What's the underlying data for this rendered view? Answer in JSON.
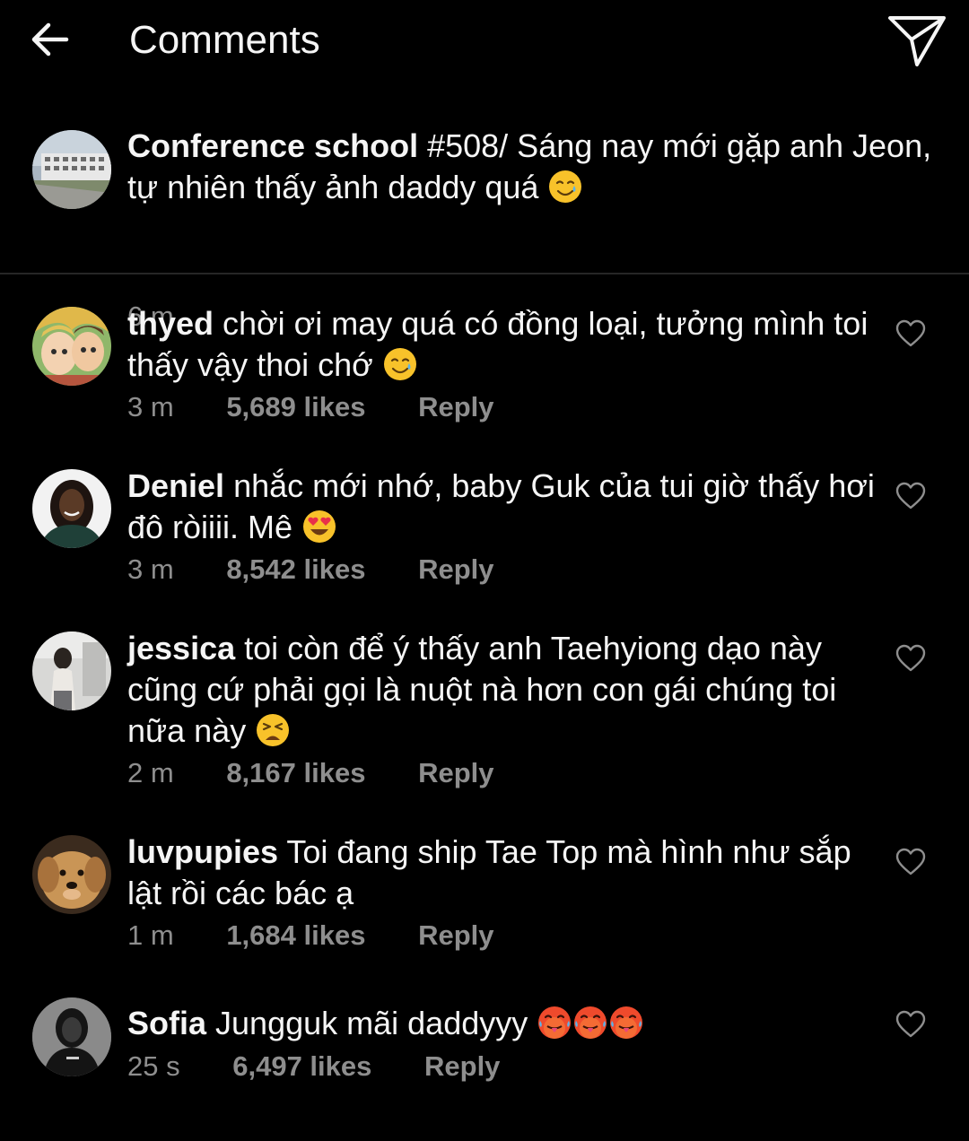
{
  "header": {
    "title": "Comments"
  },
  "caption": {
    "username": "Conference school",
    "text": "#508/ Sáng nay mới gặp anh Jeon, tự nhiên thấy ảnh daddy quá",
    "time": "6 m"
  },
  "comments": [
    {
      "username": "thyed",
      "text": "chời ơi may quá có đồng loại, tưởng mình toi thấy vậy thoi chớ",
      "time": "3 m",
      "likes": "5,689 likes",
      "reply": "Reply"
    },
    {
      "username": "Deniel",
      "text": "nhắc mới nhớ, baby Guk của tui giờ thấy hơi đô ròiiii. Mê",
      "time": "3 m",
      "likes": "8,542 likes",
      "reply": "Reply"
    },
    {
      "username": "jessica",
      "text": "toi còn để ý thấy anh Taehyiong dạo này cũng cứ phải gọi là nuột nà hơn con gái chúng toi nữa này",
      "time": "2 m",
      "likes": "8,167 likes",
      "reply": "Reply"
    },
    {
      "username": "luvpupies",
      "text": "Toi đang ship Tae Top mà hình như sắp lật rồi các bác ạ",
      "time": "1 m",
      "likes": "1,684 likes",
      "reply": "Reply"
    },
    {
      "username": "Sofia",
      "text": "Jungguk mãi daddyyy",
      "time": "25 s",
      "likes": "6,497 likes",
      "reply": "Reply"
    }
  ],
  "icons": {
    "back": "arrow-left-icon",
    "share": "paper-plane-icon",
    "like": "heart-outline-icon",
    "emoji_tear_smile": "smiling-face-with-tear-emoji",
    "emoji_heart_eyes": "heart-eyes-emoji",
    "emoji_persevering": "persevering-face-emoji",
    "emoji_hot": "hot-face-emoji"
  },
  "colors": {
    "background": "#000000",
    "text": "#f5f5f5",
    "secondary": "#8e8e8e",
    "divider": "#262626"
  }
}
